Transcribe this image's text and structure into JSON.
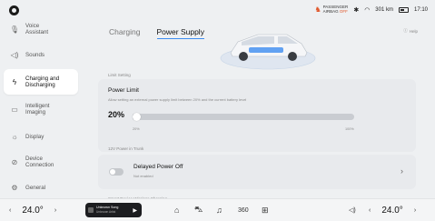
{
  "status": {
    "airbag_line1": "PASSENGER",
    "airbag_line2_prefix": "AIRBAG",
    "airbag_line2_state": "OFF",
    "range": "301 km",
    "time": "17:10"
  },
  "sidebar": {
    "items": [
      {
        "label": "Voice Assistant",
        "icon": "voice-icon"
      },
      {
        "label": "Sounds",
        "icon": "speaker-icon"
      },
      {
        "label": "Charging and Discharging",
        "icon": "charging-icon"
      },
      {
        "label": "Intelligent Imaging",
        "icon": "camera-icon"
      },
      {
        "label": "Display",
        "icon": "sun-icon"
      },
      {
        "label": "Device Connection",
        "icon": "link-icon"
      },
      {
        "label": "General",
        "icon": "gear-icon"
      }
    ]
  },
  "tabs": [
    {
      "label": "Charging"
    },
    {
      "label": "Power Supply"
    }
  ],
  "help": "Help",
  "limit_section": {
    "label": "Limit Setting",
    "title": "Power Limit",
    "desc": "Allow setting an external power supply limit between 20% and the current battery level",
    "value_label": "20%",
    "value": 20,
    "min": 20,
    "max": 100,
    "tick_min": "20%",
    "tick_max": "100%"
  },
  "power_section": {
    "label": "12V Power in Trunk",
    "title": "Delayed Power Off",
    "desc": "Not enabled",
    "enabled": false
  },
  "wireless_label": "Smart Device Wireless Charging",
  "bottom": {
    "left_temp": "24.0°",
    "right_temp": "24.0°",
    "song": "Unknown Song",
    "artist": "Unknown Artist",
    "ac_label": "360"
  },
  "colors": {
    "accent": "#3c8cf0",
    "airbag_off": "#e0562a"
  }
}
